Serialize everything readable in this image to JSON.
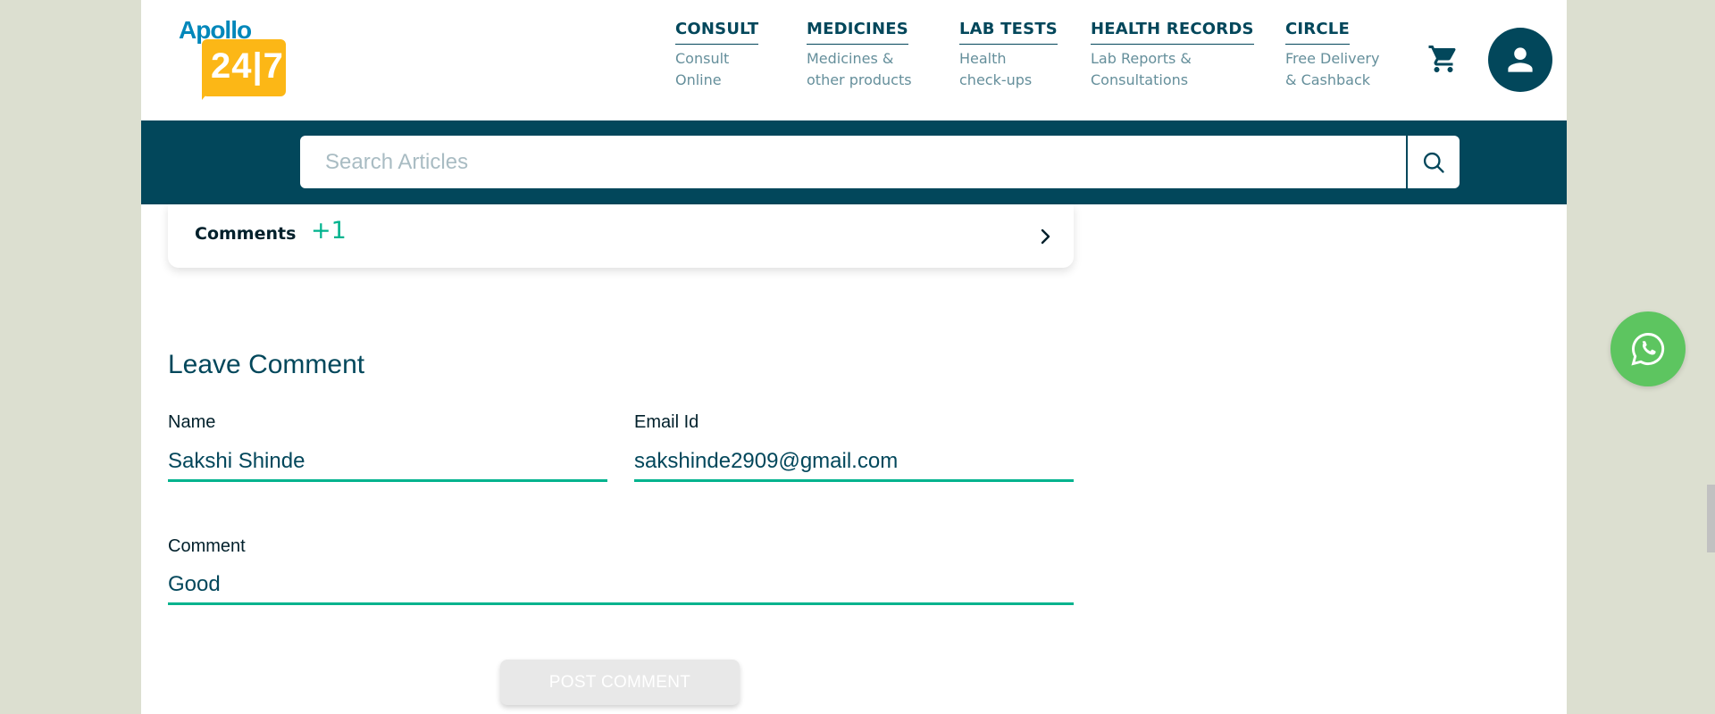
{
  "header": {
    "logo": {
      "top_text": "Apollo",
      "num_text": "24|7"
    },
    "nav": [
      {
        "title": "CONSULT",
        "sub1": "Consult",
        "sub2": "Online"
      },
      {
        "title": "MEDICINES",
        "sub1": "Medicines &",
        "sub2": "other products"
      },
      {
        "title": "LAB TESTS",
        "sub1": "Health",
        "sub2": "check-ups"
      },
      {
        "title": "HEALTH RECORDS",
        "sub1": "Lab Reports &",
        "sub2": "Consultations"
      },
      {
        "title": "CIRCLE",
        "sub1": "Free Delivery",
        "sub2": "& Cashback"
      }
    ],
    "cart_icon": "cart-icon",
    "avatar_icon": "user-icon"
  },
  "search": {
    "placeholder": "Search Articles",
    "value": "",
    "icon": "search-icon"
  },
  "comments": {
    "label": "Comments",
    "count": "+1",
    "icon": "chevron-right-icon"
  },
  "form": {
    "title": "Leave Comment",
    "name_label": "Name",
    "name_value": "Sakshi Shinde",
    "email_label": "Email Id",
    "email_value": "sakshinde2909@gmail.com",
    "comment_label": "Comment",
    "comment_value": "Good",
    "submit_label": "POST COMMENT"
  },
  "whatsapp_icon": "whatsapp-icon",
  "colors": {
    "primary": "#02475b",
    "accent": "#00b38e",
    "logo_blue": "#0087ba",
    "logo_yellow": "#fcb716",
    "whatsapp_green": "#5dc560",
    "background": "#dcdfd0"
  }
}
